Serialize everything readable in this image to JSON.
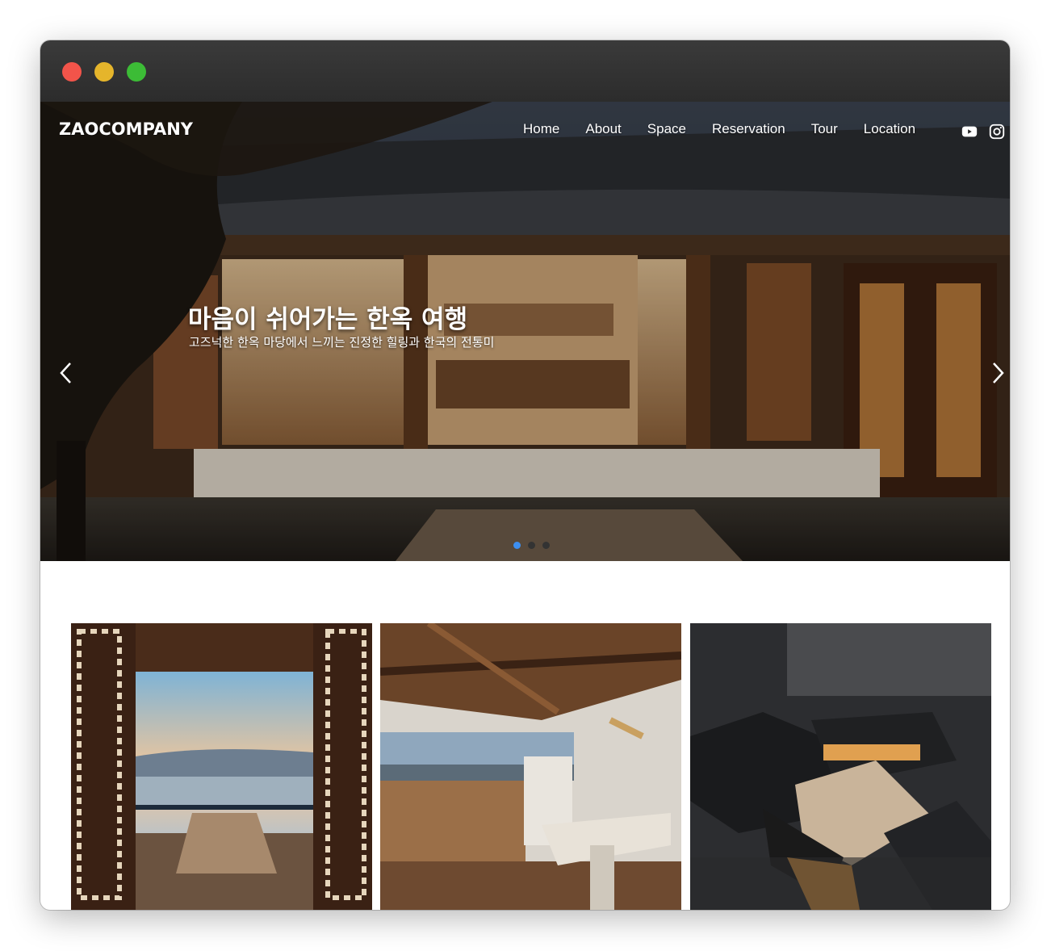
{
  "window": {
    "controls": [
      "close",
      "minimize",
      "maximize"
    ]
  },
  "nav": {
    "logo": "ZAOCOMPANY",
    "items": [
      {
        "label": "Home"
      },
      {
        "label": "About"
      },
      {
        "label": "Space"
      },
      {
        "label": "Reservation"
      },
      {
        "label": "Tour"
      },
      {
        "label": "Location"
      }
    ],
    "social": [
      "youtube-icon",
      "instagram-icon"
    ]
  },
  "hero": {
    "headline": "마음이 쉬어가는 한옥 여행",
    "subline": "고즈넉한 한옥 마당에서 느끼는 진정한 힐링과 한국의 전통미",
    "slides_total": 3,
    "active_slide": 1
  },
  "gallery": {
    "tiles": [
      "window-sea-view",
      "dining-kitchen",
      "aerial-night-hanok"
    ]
  },
  "colors": {
    "accent": "#3d8ff0",
    "titlebar": "#2f2f2f",
    "close": "#f2544a",
    "minimize": "#e5b52b",
    "maximize": "#3cbc36"
  }
}
